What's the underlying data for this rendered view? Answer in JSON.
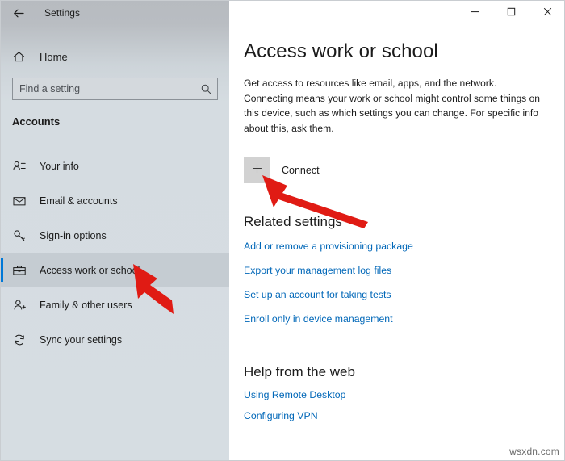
{
  "window": {
    "app_title": "Settings",
    "back_icon": "back-arrow-icon",
    "controls": {
      "minimize": "minimize-icon",
      "maximize": "maximize-icon",
      "close": "close-icon"
    }
  },
  "sidebar": {
    "home": {
      "label": "Home",
      "icon": "home-icon"
    },
    "search": {
      "placeholder": "Find a setting",
      "value": "",
      "icon": "search-icon"
    },
    "section_title": "Accounts",
    "items": [
      {
        "label": "Your info",
        "icon": "user-info-icon",
        "selected": false
      },
      {
        "label": "Email & accounts",
        "icon": "envelope-icon",
        "selected": false
      },
      {
        "label": "Sign-in options",
        "icon": "key-icon",
        "selected": false
      },
      {
        "label": "Access work or school",
        "icon": "briefcase-icon",
        "selected": true
      },
      {
        "label": "Family & other users",
        "icon": "user-add-icon",
        "selected": false
      },
      {
        "label": "Sync your settings",
        "icon": "sync-icon",
        "selected": false
      }
    ]
  },
  "main": {
    "title": "Access work or school",
    "description": "Get access to resources like email, apps, and the network. Connecting means your work or school might control some things on this device, such as which settings you can change. For specific info about this, ask them.",
    "connect": {
      "label": "Connect",
      "icon": "plus-icon"
    },
    "related": {
      "heading": "Related settings",
      "links": [
        "Add or remove a provisioning package",
        "Export your management log files",
        "Set up an account for taking tests",
        "Enroll only in device management"
      ]
    },
    "help": {
      "heading": "Help from the web",
      "links": [
        "Using Remote Desktop",
        "Configuring VPN"
      ]
    }
  },
  "annotations": {
    "arrow_color": "#e01b14",
    "arrows": [
      {
        "name": "arrow-pointing-to-access-work-or-school"
      },
      {
        "name": "arrow-pointing-to-connect-button"
      }
    ]
  },
  "watermark": {
    "text": "wsxdn.com"
  },
  "colors": {
    "accent": "#0078d7",
    "link": "#0067b8",
    "sidebar_bg": "#d6dde2",
    "selected_bg": "#c5ccd2",
    "connect_btn_bg": "#d2d2d2"
  }
}
